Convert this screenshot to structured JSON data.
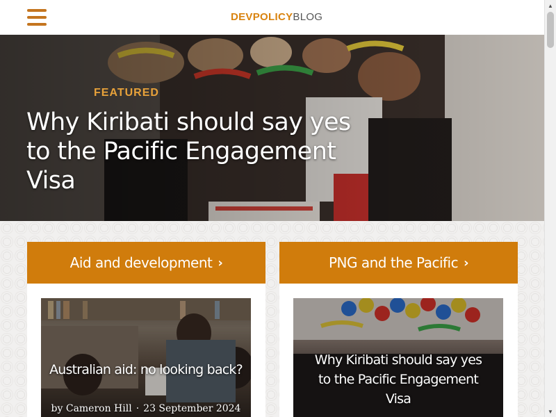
{
  "header": {
    "menu_icon": "hamburger-menu-icon",
    "logo_brand": "DEVPOLICY",
    "logo_suffix": "BLOG"
  },
  "hero": {
    "label": "FEATURED",
    "title": "Why Kiribati should say yes to the Pacific Engagement Visa"
  },
  "sections": [
    {
      "label": "Aid and development",
      "chevron": "›",
      "post": {
        "title": "Australian aid: no looking back?",
        "author": "by Cameron Hill",
        "date": "23 September 2024"
      }
    },
    {
      "label": "PNG and the Pacific",
      "chevron": "›",
      "post": {
        "title": "Why Kiribati should say yes to the Pacific Engagement Visa"
      }
    }
  ],
  "colors": {
    "accent": "#d07c0c",
    "brand": "#d9830f",
    "featured_label": "#e8a23a"
  }
}
